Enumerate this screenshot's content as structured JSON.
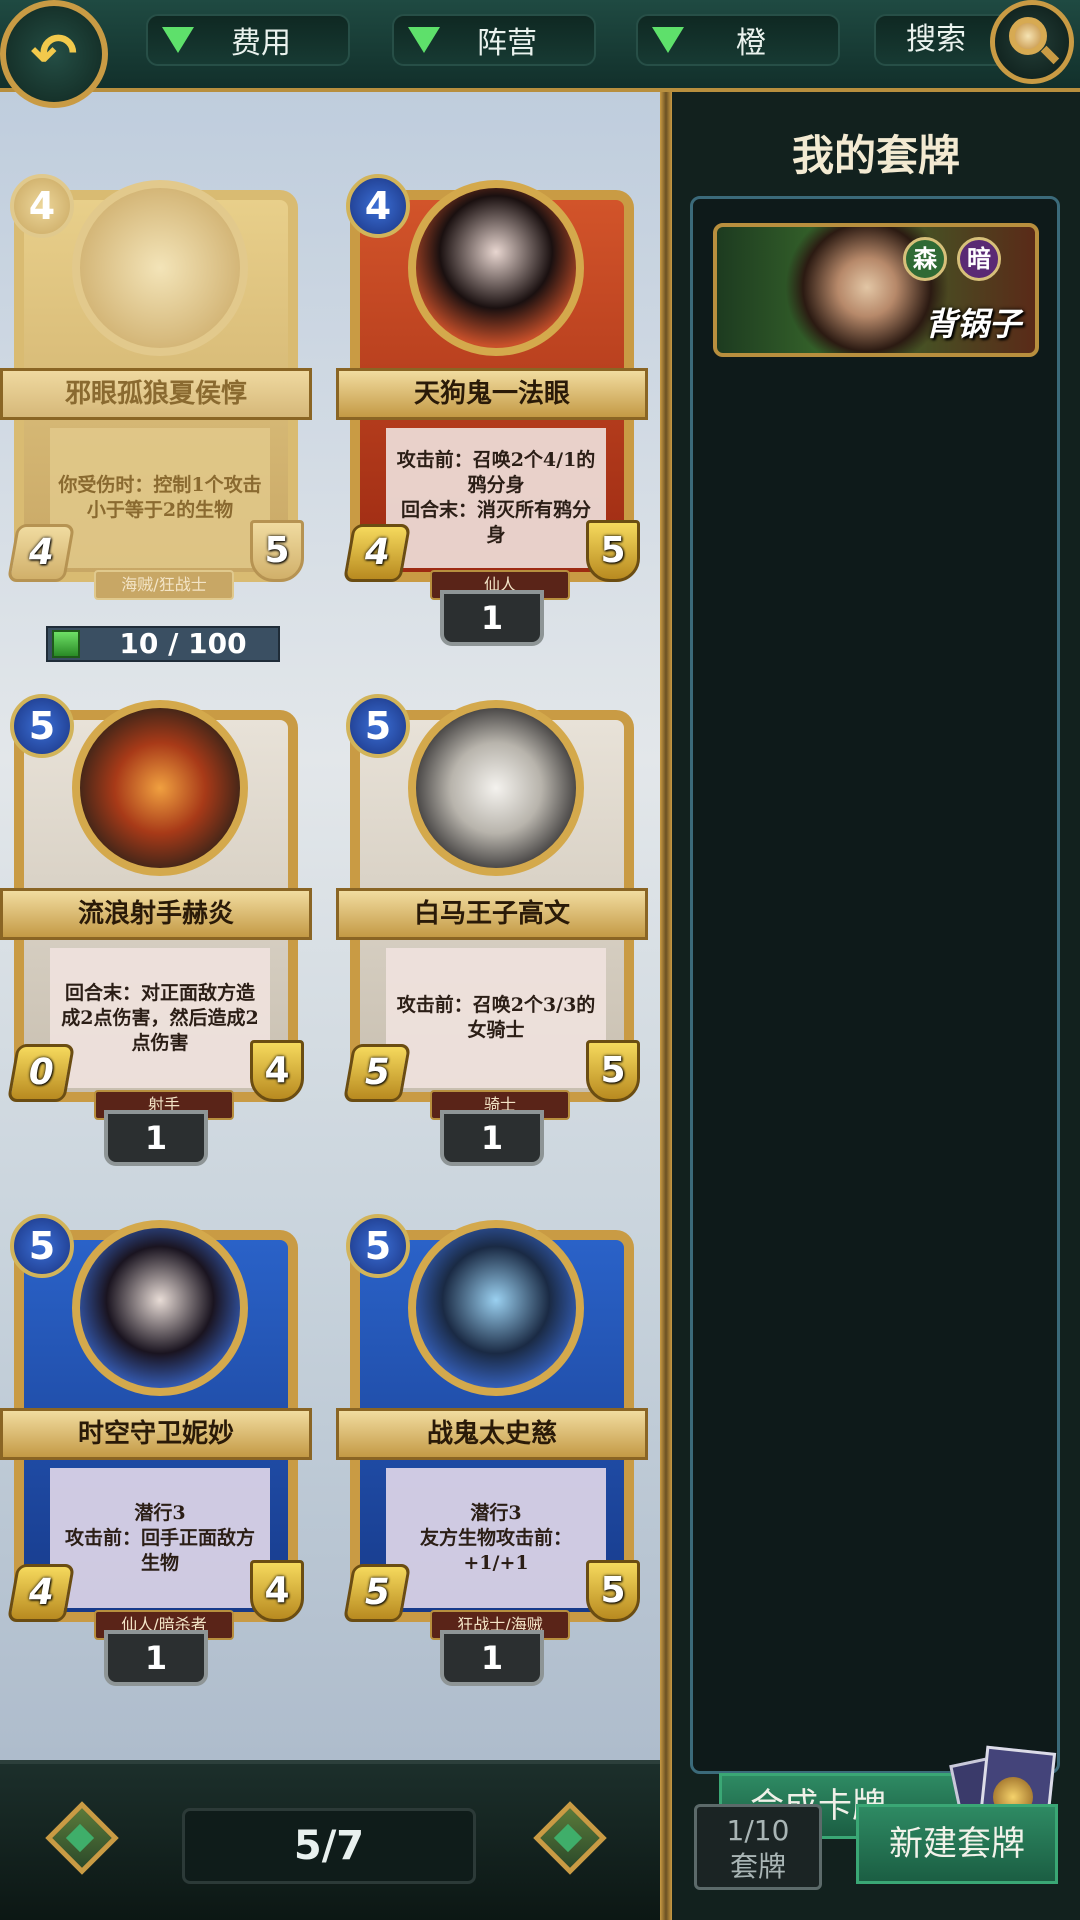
{
  "topbar": {
    "filters": [
      {
        "label": "费用"
      },
      {
        "label": "阵营"
      },
      {
        "label": "橙"
      }
    ],
    "search_label": "搜索"
  },
  "colors": {
    "accent_gold": "#c99b44",
    "button_green": "#2e8a63",
    "filter_arrow": "#5ee06b"
  },
  "cards": [
    {
      "name": "邪眼孤狼夏侯惇",
      "cost": "4",
      "attack": "4",
      "health": "5",
      "text": "你受伤时：控制1个攻击小于等于2的生物",
      "race": "海贼/狂战士",
      "style": "gold",
      "progress": "10 / 100"
    },
    {
      "name": "天狗鬼一法眼",
      "cost": "4",
      "attack": "4",
      "health": "5",
      "text": "攻击前：召唤2个4/1的鸦分身\n回合末：消灭所有鸦分身",
      "race": "仙人",
      "count": "1",
      "style": "red"
    },
    {
      "name": "流浪射手赫炎",
      "cost": "5",
      "attack": "0",
      "health": "4",
      "text": "回合末：对正面敌方造成2点伤害，然后造成2点伤害",
      "race": "射手",
      "count": "1",
      "style": "white"
    },
    {
      "name": "白马王子高文",
      "cost": "5",
      "attack": "5",
      "health": "5",
      "text": "攻击前：召唤2个3/3的女骑士",
      "race": "骑士",
      "count": "1",
      "style": "white"
    },
    {
      "name": "时空守卫妮妙",
      "cost": "5",
      "attack": "4",
      "health": "4",
      "text": "潜行3\n攻击前：回手正面敌方生物",
      "race": "仙人/暗杀者",
      "count": "1",
      "style": "blue"
    },
    {
      "name": "战鬼太史慈",
      "cost": "5",
      "attack": "5",
      "health": "5",
      "text": "潜行3\n友方生物攻击前：+1/+1",
      "race": "狂战士/海贼",
      "count": "1",
      "style": "blue"
    }
  ],
  "pagination": {
    "label": "5/7"
  },
  "deck_panel": {
    "title": "我的套牌",
    "deck": {
      "name": "背锅子",
      "factions": [
        "森",
        "暗"
      ]
    },
    "craft_label": "合成卡牌",
    "deck_count": "1/10",
    "deck_count_label": "套牌",
    "new_deck_label": "新建套牌"
  }
}
